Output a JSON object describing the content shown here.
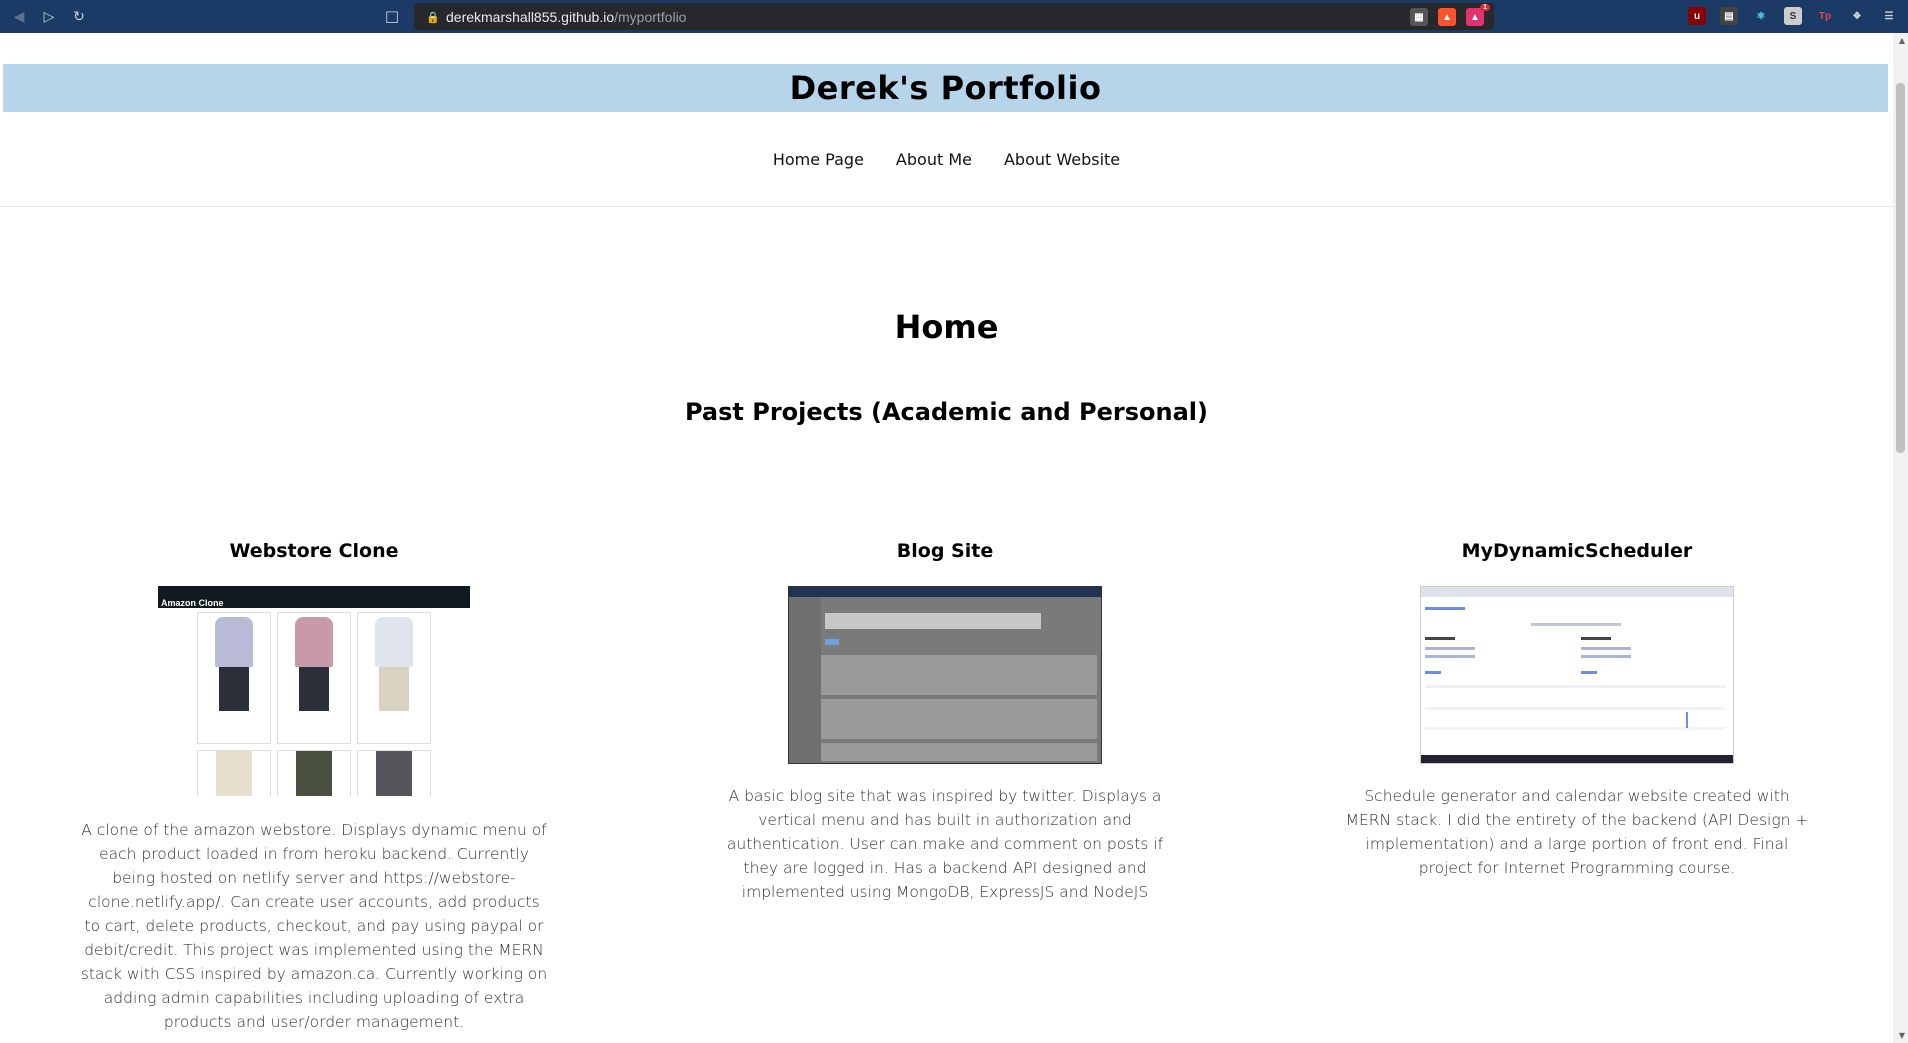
{
  "browser": {
    "url_host": "derekmarshall855.github.io",
    "url_path": "/myportfolio",
    "extension_badge": "1"
  },
  "site": {
    "title": "Derek's Portfolio",
    "nav": [
      {
        "label": "Home Page"
      },
      {
        "label": "About Me"
      },
      {
        "label": "About Website"
      }
    ]
  },
  "main": {
    "heading": "Home",
    "subheading": "Past Projects (Academic and Personal)",
    "projects": [
      {
        "title": "Webstore Clone",
        "thumb_header": "Amazon Clone",
        "description": "A clone of the amazon webstore. Displays dynamic menu of each product loaded in from heroku backend. Currently being hosted on netlify server and https://webstore-clone.netlify.app/. Can create user accounts, add products to cart, delete products, checkout, and pay using paypal or debit/credit. This project was implemented using the MERN stack with CSS inspired by amazon.ca. Currently working on adding admin capabilities including uploading of extra products and user/order management."
      },
      {
        "title": "Blog Site",
        "description": "A basic blog site that was inspired by twitter. Displays a vertical menu and has built in authorization and authentication. User can make and comment on posts if they are logged in. Has a backend API designed and implemented using MongoDB, ExpressJS and NodeJS"
      },
      {
        "title": "MyDynamicScheduler",
        "description": "Schedule generator and calendar website created with MERN stack. I did the entirety of the backend (API Design + implementation) and a large portion of front end. Final project for Internet Programming course."
      }
    ]
  }
}
